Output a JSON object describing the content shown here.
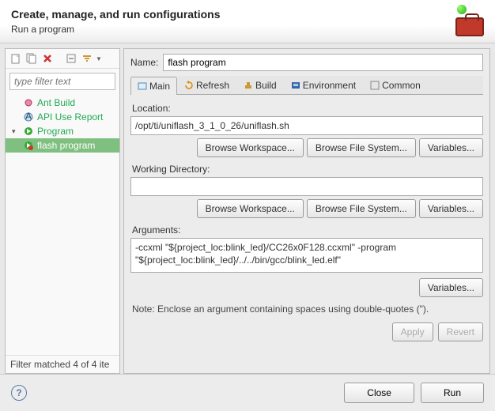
{
  "header": {
    "title": "Create, manage, and run configurations",
    "subtitle": "Run a program"
  },
  "toolbar": {
    "new": "new-config",
    "duplicate": "duplicate",
    "delete": "delete",
    "collapse": "collapse-all",
    "filter": "filter"
  },
  "filter": {
    "placeholder": "type filter text",
    "status": "Filter matched 4 of 4 ite"
  },
  "tree": {
    "items": [
      {
        "label": "Ant Build",
        "icon": "ant-icon"
      },
      {
        "label": "API Use Report",
        "icon": "api-icon"
      },
      {
        "label": "Program",
        "icon": "program-icon",
        "expanded": true
      },
      {
        "label": "flash program",
        "icon": "program-child-icon",
        "child": true,
        "selected": true
      }
    ]
  },
  "form": {
    "name_label": "Name:",
    "name_value": "flash program",
    "tabs": [
      {
        "label": "Main",
        "active": true
      },
      {
        "label": "Refresh"
      },
      {
        "label": "Build"
      },
      {
        "label": "Environment"
      },
      {
        "label": "Common"
      }
    ],
    "location_label": "Location:",
    "location_value": "/opt/ti/uniflash_3_1_0_26/uniflash.sh",
    "browse_workspace": "Browse Workspace...",
    "browse_filesystem": "Browse File System...",
    "variables": "Variables...",
    "workdir_label": "Working Directory:",
    "workdir_value": "",
    "arguments_label": "Arguments:",
    "arguments_value": "-ccxml \"${project_loc:blink_led}/CC26x0F128.ccxml\" -program \"${project_loc:blink_led}/../../bin/gcc/blink_led.elf\"",
    "note": "Note: Enclose an argument containing spaces using double-quotes (\").",
    "apply": "Apply",
    "revert": "Revert"
  },
  "footer": {
    "close": "Close",
    "run": "Run"
  }
}
